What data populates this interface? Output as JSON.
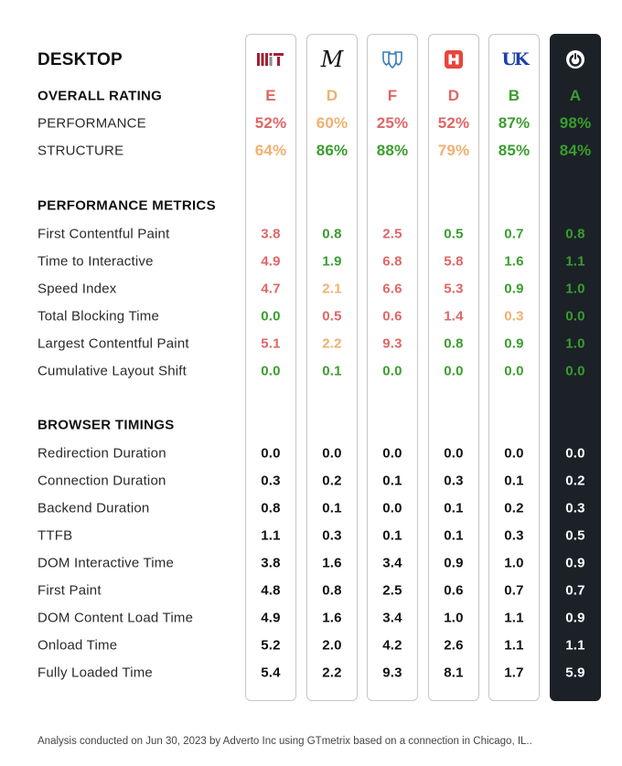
{
  "title": "DESKTOP",
  "colors": {
    "red": "#e06666",
    "orange": "#f0b070",
    "green": "#3a9d2e",
    "black": "#111111",
    "white": "#ffffff",
    "dark_column_bg": "#1b2127"
  },
  "columns": [
    {
      "name": "mit",
      "logo": "mit-logo"
    },
    {
      "name": "michigan",
      "logo": "m-script-logo"
    },
    {
      "name": "mayo",
      "logo": "shield-logo"
    },
    {
      "name": "houston",
      "logo": "h-logo"
    },
    {
      "name": "kentucky",
      "logo": "uk-logo"
    },
    {
      "name": "adverto",
      "logo": "power-icon",
      "highlight": true
    }
  ],
  "overall": {
    "header": "OVERALL RATING",
    "grades": [
      {
        "v": "E",
        "c": "red"
      },
      {
        "v": "D",
        "c": "orange"
      },
      {
        "v": "F",
        "c": "red"
      },
      {
        "v": "D",
        "c": "red"
      },
      {
        "v": "B",
        "c": "green"
      },
      {
        "v": "A",
        "c": "green"
      }
    ],
    "rows": [
      {
        "label": "PERFORMANCE",
        "values": [
          {
            "v": "52%",
            "c": "red"
          },
          {
            "v": "60%",
            "c": "orange"
          },
          {
            "v": "25%",
            "c": "red"
          },
          {
            "v": "52%",
            "c": "red"
          },
          {
            "v": "87%",
            "c": "green"
          },
          {
            "v": "98%",
            "c": "green"
          }
        ]
      },
      {
        "label": "STRUCTURE",
        "values": [
          {
            "v": "64%",
            "c": "orange"
          },
          {
            "v": "86%",
            "c": "green"
          },
          {
            "v": "88%",
            "c": "green"
          },
          {
            "v": "79%",
            "c": "orange"
          },
          {
            "v": "85%",
            "c": "green"
          },
          {
            "v": "84%",
            "c": "green"
          }
        ]
      }
    ]
  },
  "performance_metrics": {
    "header": "PERFORMANCE METRICS",
    "rows": [
      {
        "label": "First Contentful Paint",
        "values": [
          {
            "v": "3.8",
            "c": "red"
          },
          {
            "v": "0.8",
            "c": "green"
          },
          {
            "v": "2.5",
            "c": "red"
          },
          {
            "v": "0.5",
            "c": "green"
          },
          {
            "v": "0.7",
            "c": "green"
          },
          {
            "v": "0.8",
            "c": "green"
          }
        ]
      },
      {
        "label": "Time to Interactive",
        "values": [
          {
            "v": "4.9",
            "c": "red"
          },
          {
            "v": "1.9",
            "c": "green"
          },
          {
            "v": "6.8",
            "c": "red"
          },
          {
            "v": "5.8",
            "c": "red"
          },
          {
            "v": "1.6",
            "c": "green"
          },
          {
            "v": "1.1",
            "c": "green"
          }
        ]
      },
      {
        "label": "Speed Index",
        "values": [
          {
            "v": "4.7",
            "c": "red"
          },
          {
            "v": "2.1",
            "c": "orange"
          },
          {
            "v": "6.6",
            "c": "red"
          },
          {
            "v": "5.3",
            "c": "red"
          },
          {
            "v": "0.9",
            "c": "green"
          },
          {
            "v": "1.0",
            "c": "green"
          }
        ]
      },
      {
        "label": "Total Blocking Time",
        "values": [
          {
            "v": "0.0",
            "c": "green"
          },
          {
            "v": "0.5",
            "c": "red"
          },
          {
            "v": "0.6",
            "c": "red"
          },
          {
            "v": "1.4",
            "c": "red"
          },
          {
            "v": "0.3",
            "c": "orange"
          },
          {
            "v": "0.0",
            "c": "green"
          }
        ]
      },
      {
        "label": "Largest Contentful Paint",
        "values": [
          {
            "v": "5.1",
            "c": "red"
          },
          {
            "v": "2.2",
            "c": "orange"
          },
          {
            "v": "9.3",
            "c": "red"
          },
          {
            "v": "0.8",
            "c": "green"
          },
          {
            "v": "0.9",
            "c": "green"
          },
          {
            "v": "1.0",
            "c": "green"
          }
        ]
      },
      {
        "label": "Cumulative Layout Shift",
        "values": [
          {
            "v": "0.0",
            "c": "green"
          },
          {
            "v": "0.1",
            "c": "green"
          },
          {
            "v": "0.0",
            "c": "green"
          },
          {
            "v": "0.0",
            "c": "green"
          },
          {
            "v": "0.0",
            "c": "green"
          },
          {
            "v": "0.0",
            "c": "green"
          }
        ]
      }
    ]
  },
  "browser_timings": {
    "header": "BROWSER TIMINGS",
    "rows": [
      {
        "label": "Redirection Duration",
        "values": [
          "0.0",
          "0.0",
          "0.0",
          "0.0",
          "0.0",
          "0.0"
        ]
      },
      {
        "label": "Connection Duration",
        "values": [
          "0.3",
          "0.2",
          "0.1",
          "0.3",
          "0.1",
          "0.2"
        ]
      },
      {
        "label": "Backend Duration",
        "values": [
          "0.8",
          "0.1",
          "0.0",
          "0.1",
          "0.2",
          "0.3"
        ]
      },
      {
        "label": "TTFB",
        "values": [
          "1.1",
          "0.3",
          "0.1",
          "0.1",
          "0.3",
          "0.5"
        ]
      },
      {
        "label": "DOM Interactive Time",
        "values": [
          "3.8",
          "1.6",
          "3.4",
          "0.9",
          "1.0",
          "0.9"
        ]
      },
      {
        "label": "First Paint",
        "values": [
          "4.8",
          "0.8",
          "2.5",
          "0.6",
          "0.7",
          "0.7"
        ]
      },
      {
        "label": "DOM Content Load Time",
        "values": [
          "4.9",
          "1.6",
          "3.4",
          "1.0",
          "1.1",
          "0.9"
        ]
      },
      {
        "label": "Onload Time",
        "values": [
          "5.2",
          "2.0",
          "4.2",
          "2.6",
          "1.1",
          "1.1"
        ]
      },
      {
        "label": "Fully Loaded Time",
        "values": [
          "5.4",
          "2.2",
          "9.3",
          "8.1",
          "1.7",
          "5.9"
        ]
      }
    ]
  },
  "footer": "Analysis conducted on Jun 30, 2023 by Adverto Inc using GTmetrix based on a connection in Chicago, IL.."
}
